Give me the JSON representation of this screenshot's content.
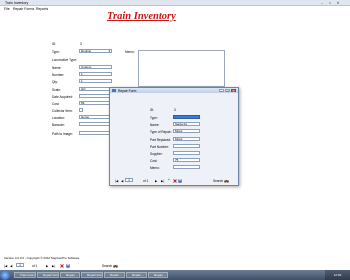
{
  "window": {
    "title": "Train Inventory",
    "controls": [
      "–",
      "□",
      "✕"
    ]
  },
  "menu": [
    "File",
    "Repair Forms",
    "Reports"
  ],
  "heading": "Train Inventory",
  "form": {
    "labels": {
      "id": "ID:",
      "type": "Type:",
      "loco_type": "Locomotive Type:",
      "name": "Name:",
      "number": "Number:",
      "qty": "Qty:",
      "scale": "Scale:",
      "date_acquired": "Date Acquired:",
      "cost": "Cost:",
      "collector": "Collector Item:",
      "location": "Location:",
      "barcode": "Barcode:",
      "path_to_image": "Path to Image:",
      "memo": "Memo:"
    },
    "values": {
      "id": "3",
      "type": "Rooling",
      "name": "Custom",
      "number": "1",
      "qty": "1",
      "scale": "HO",
      "cost": "59",
      "location": "Home"
    }
  },
  "repair_dialog": {
    "title": "Repair Form",
    "labels": {
      "id": "ID:",
      "type": "Type:",
      "name": "Name:",
      "type_of_repair": "Type of Repair:",
      "part_replaced": "Part Replaced:",
      "part_number": "Part Number:",
      "supplier": "Supplier:",
      "cost": "Cost:",
      "memo": "Memo:"
    },
    "values": {
      "id": "3",
      "type": "",
      "name": "Santa Fe",
      "type_of_repair": "Motor",
      "part_replaced": "Motor",
      "cost": "75"
    },
    "nav": {
      "first": "|◀",
      "prev": "◀",
      "position": "1",
      "of_text": "of 1",
      "next": "▶",
      "last": "▶|",
      "add": "+",
      "search_label": "Search"
    }
  },
  "main_nav": {
    "first": "|◀",
    "prev": "◀",
    "position": "1",
    "of_text": "of 1",
    "next": "▶",
    "last": "▶|",
    "search_label": "Search"
  },
  "status": {
    "version": "Version 4.0.0.0 - Copyright © 2012 StephenPro Software"
  },
  "taskbar": {
    "items": [
      "Train Inventory",
      "Repair Form",
      "Repair ...",
      "Repair Form ...",
      "Repair ...",
      "Repair ...",
      "Repair ..."
    ],
    "clock": "12:00"
  },
  "colors": {
    "accent": "#c81414",
    "selection": "#3a7bd5"
  }
}
